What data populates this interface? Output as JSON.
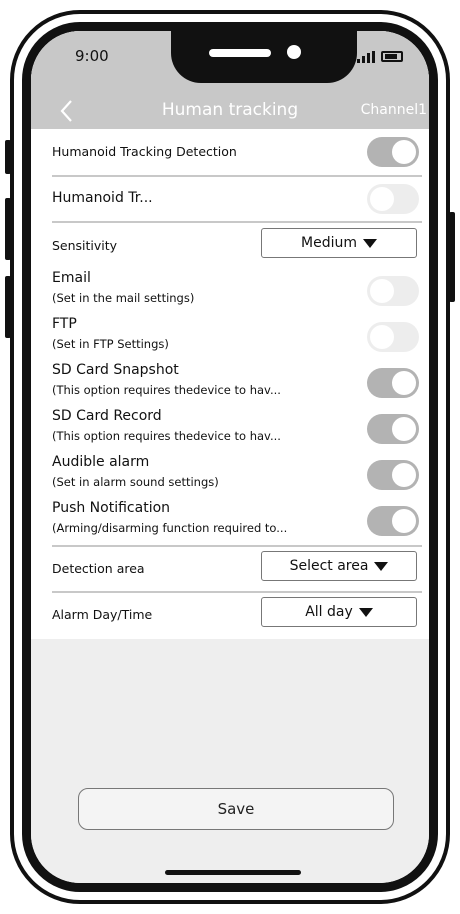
{
  "status_bar": {
    "time": "9:00"
  },
  "header": {
    "back_icon": "chevron-left-icon",
    "title": "Human tracking",
    "channel": "Channel1"
  },
  "settings": {
    "humanoid_tracking_detection": {
      "label": "Humanoid Tracking Detection",
      "enabled": true
    },
    "humanoid_tracking_truncated": {
      "label": "Humanoid Tr...",
      "enabled": false
    },
    "sensitivity": {
      "label": "Sensitivity",
      "value": "Medium"
    },
    "email": {
      "label": "Email",
      "sub": "(Set in the mail settings)",
      "enabled": false
    },
    "ftp": {
      "label": "FTP",
      "sub": "(Set in FTP Settings)",
      "enabled": false
    },
    "sd_snapshot": {
      "label": "SD Card Snapshot",
      "sub": "(This option requires thedevice to hav...",
      "enabled": true
    },
    "sd_record": {
      "label": "SD Card Record",
      "sub": "(This option requires thedevice to hav...",
      "enabled": true
    },
    "audible_alarm": {
      "label": "Audible alarm",
      "sub": "(Set in alarm sound settings)",
      "enabled": true
    },
    "push_notification": {
      "label": "Push Notification",
      "sub": "(Arming/disarming function required to...",
      "enabled": true
    },
    "detection_area": {
      "label": "Detection area",
      "value": "Select area"
    },
    "alarm_day_time": {
      "label": "Alarm Day/Time",
      "value": "All day"
    }
  },
  "footer": {
    "save_label": "Save"
  },
  "colors": {
    "header_bg": "#c8c8c8",
    "toggle_on": "#b3b3b3",
    "toggle_off": "#ededed",
    "screen_bg": "#eeeeee"
  }
}
